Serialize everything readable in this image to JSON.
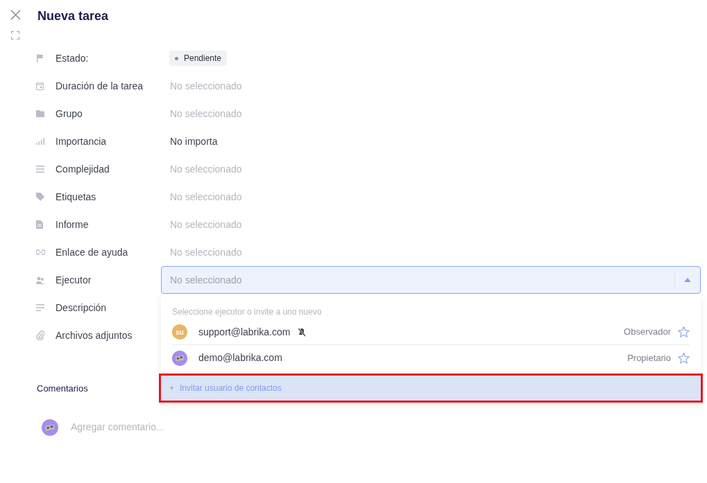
{
  "title": "Nueva tarea",
  "fields": [
    {
      "label": "Estado:",
      "kind": "badge",
      "value": "Pendiente"
    },
    {
      "label": "Duración de la tarea",
      "kind": "empty",
      "placeholder": "No seleccionado"
    },
    {
      "label": "Grupo",
      "kind": "empty",
      "placeholder": "No seleccionado"
    },
    {
      "label": "Importancia",
      "kind": "set",
      "value": "No importa"
    },
    {
      "label": "Complejidad",
      "kind": "empty",
      "placeholder": "No seleccionado"
    },
    {
      "label": "Etiquetas",
      "kind": "empty",
      "placeholder": "No seleccionado"
    },
    {
      "label": "Informe",
      "kind": "empty",
      "placeholder": "No seleccionado"
    },
    {
      "label": "Enlace de ayuda",
      "kind": "empty",
      "placeholder": "No seleccionado"
    },
    {
      "label": "Ejecutor",
      "kind": "select",
      "placeholder": "No seleccionado",
      "expanded": true
    },
    {
      "label": "Descripción",
      "kind": "hidden"
    },
    {
      "label": "Archivos adjuntos",
      "kind": "hidden"
    }
  ],
  "dropdown": {
    "hint": "Seleccione ejecutor o invite a uno nuevo",
    "users": [
      {
        "kind": "initials",
        "initials": "su",
        "email": "support@labrika.com",
        "muted": true,
        "role": "Observador"
      },
      {
        "kind": "picture",
        "email": "demo@labrika.com",
        "muted": false,
        "role": "Propietario"
      }
    ],
    "invite": {
      "plus": "+",
      "label": "Invitar usuario de contactos",
      "highlighted": true
    }
  },
  "comments": {
    "title": "Comentarios",
    "placeholder": "Agregar comentario..."
  }
}
